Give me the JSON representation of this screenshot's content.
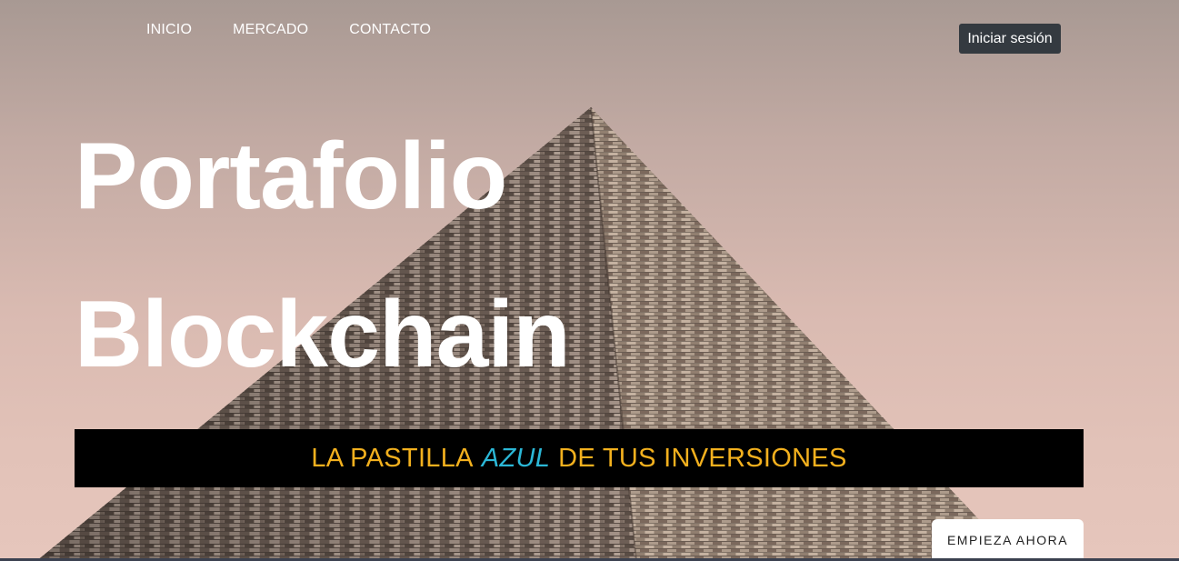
{
  "nav": {
    "items": [
      {
        "label": "INICIO"
      },
      {
        "label": "MERCADO"
      },
      {
        "label": "CONTACTO"
      }
    ],
    "login_label": "Iniciar sesión"
  },
  "hero": {
    "title_line1": "Portafolio",
    "title_line2": "Blockchain",
    "tagline": {
      "before": "LA PASTILLA",
      "accent": "AZUL",
      "after": "DE TUS INVERSIONES"
    },
    "cta_label": "EMPIEZA AHORA",
    "background_image": "pyramid-photo"
  },
  "colors": {
    "tagline_text": "#f2b01e",
    "tagline_accent": "#2bb7d6",
    "login_button_bg": "#343a40",
    "tagline_bar_bg": "#000000"
  }
}
